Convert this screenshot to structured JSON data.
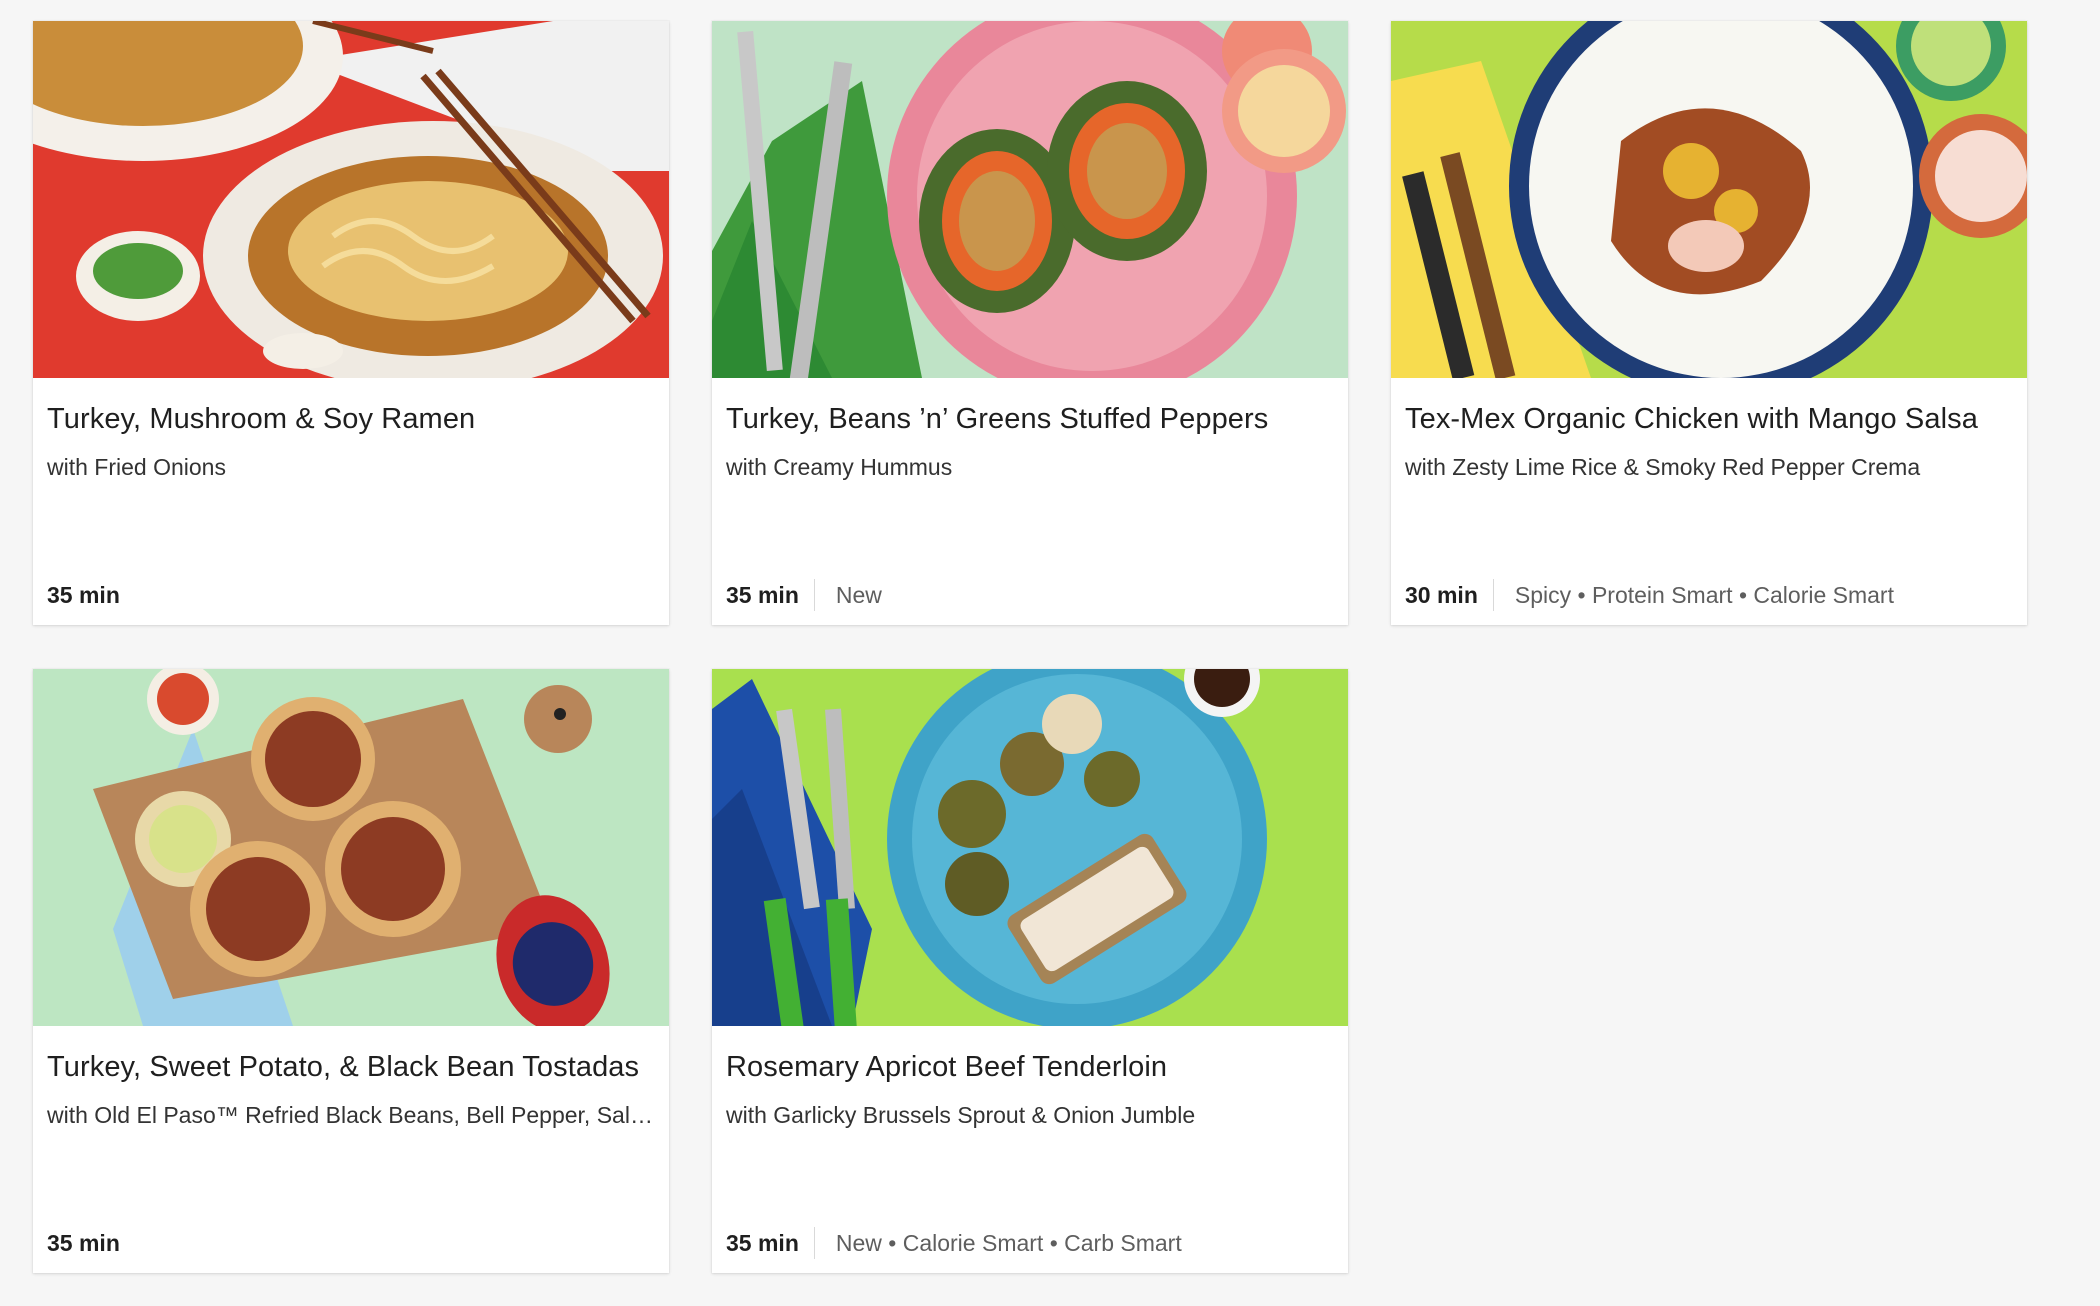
{
  "recipes": [
    {
      "title": "Turkey, Mushroom & Soy Ramen",
      "subtitle": "with Fried Onions",
      "time": "35 min",
      "tags": ""
    },
    {
      "title": "Turkey, Beans ’n’ Greens Stuffed Peppers",
      "subtitle": "with Creamy Hummus",
      "time": "35 min",
      "tags": "New"
    },
    {
      "title": "Tex-Mex Organic Chicken with Mango Salsa",
      "subtitle": "with Zesty Lime Rice & Smoky Red Pepper Crema",
      "time": "30 min",
      "tags": "Spicy • Protein Smart • Calorie Smart"
    },
    {
      "title": "Turkey, Sweet Potato, & Black Bean Tostadas",
      "subtitle": "with Old El Paso™ Refried Black Beans, Bell Pepper, Salsa & Avocado Crema",
      "time": "35 min",
      "tags": ""
    },
    {
      "title": "Rosemary Apricot Beef Tenderloin",
      "subtitle": "with Garlicky Brussels Sprout & Onion Jumble",
      "time": "35 min",
      "tags": "New • Calorie Smart • Carb Smart"
    }
  ],
  "photo_backgrounds": [
    "#e03a2e",
    "#bfe3c6",
    "#b6dc4a",
    "#bde6c2",
    "#a9e04e"
  ],
  "colors": {
    "page_bg": "#f6f6f6",
    "card_bg": "#ffffff",
    "text": "#1f1f1f",
    "muted": "#5e5e5e"
  }
}
